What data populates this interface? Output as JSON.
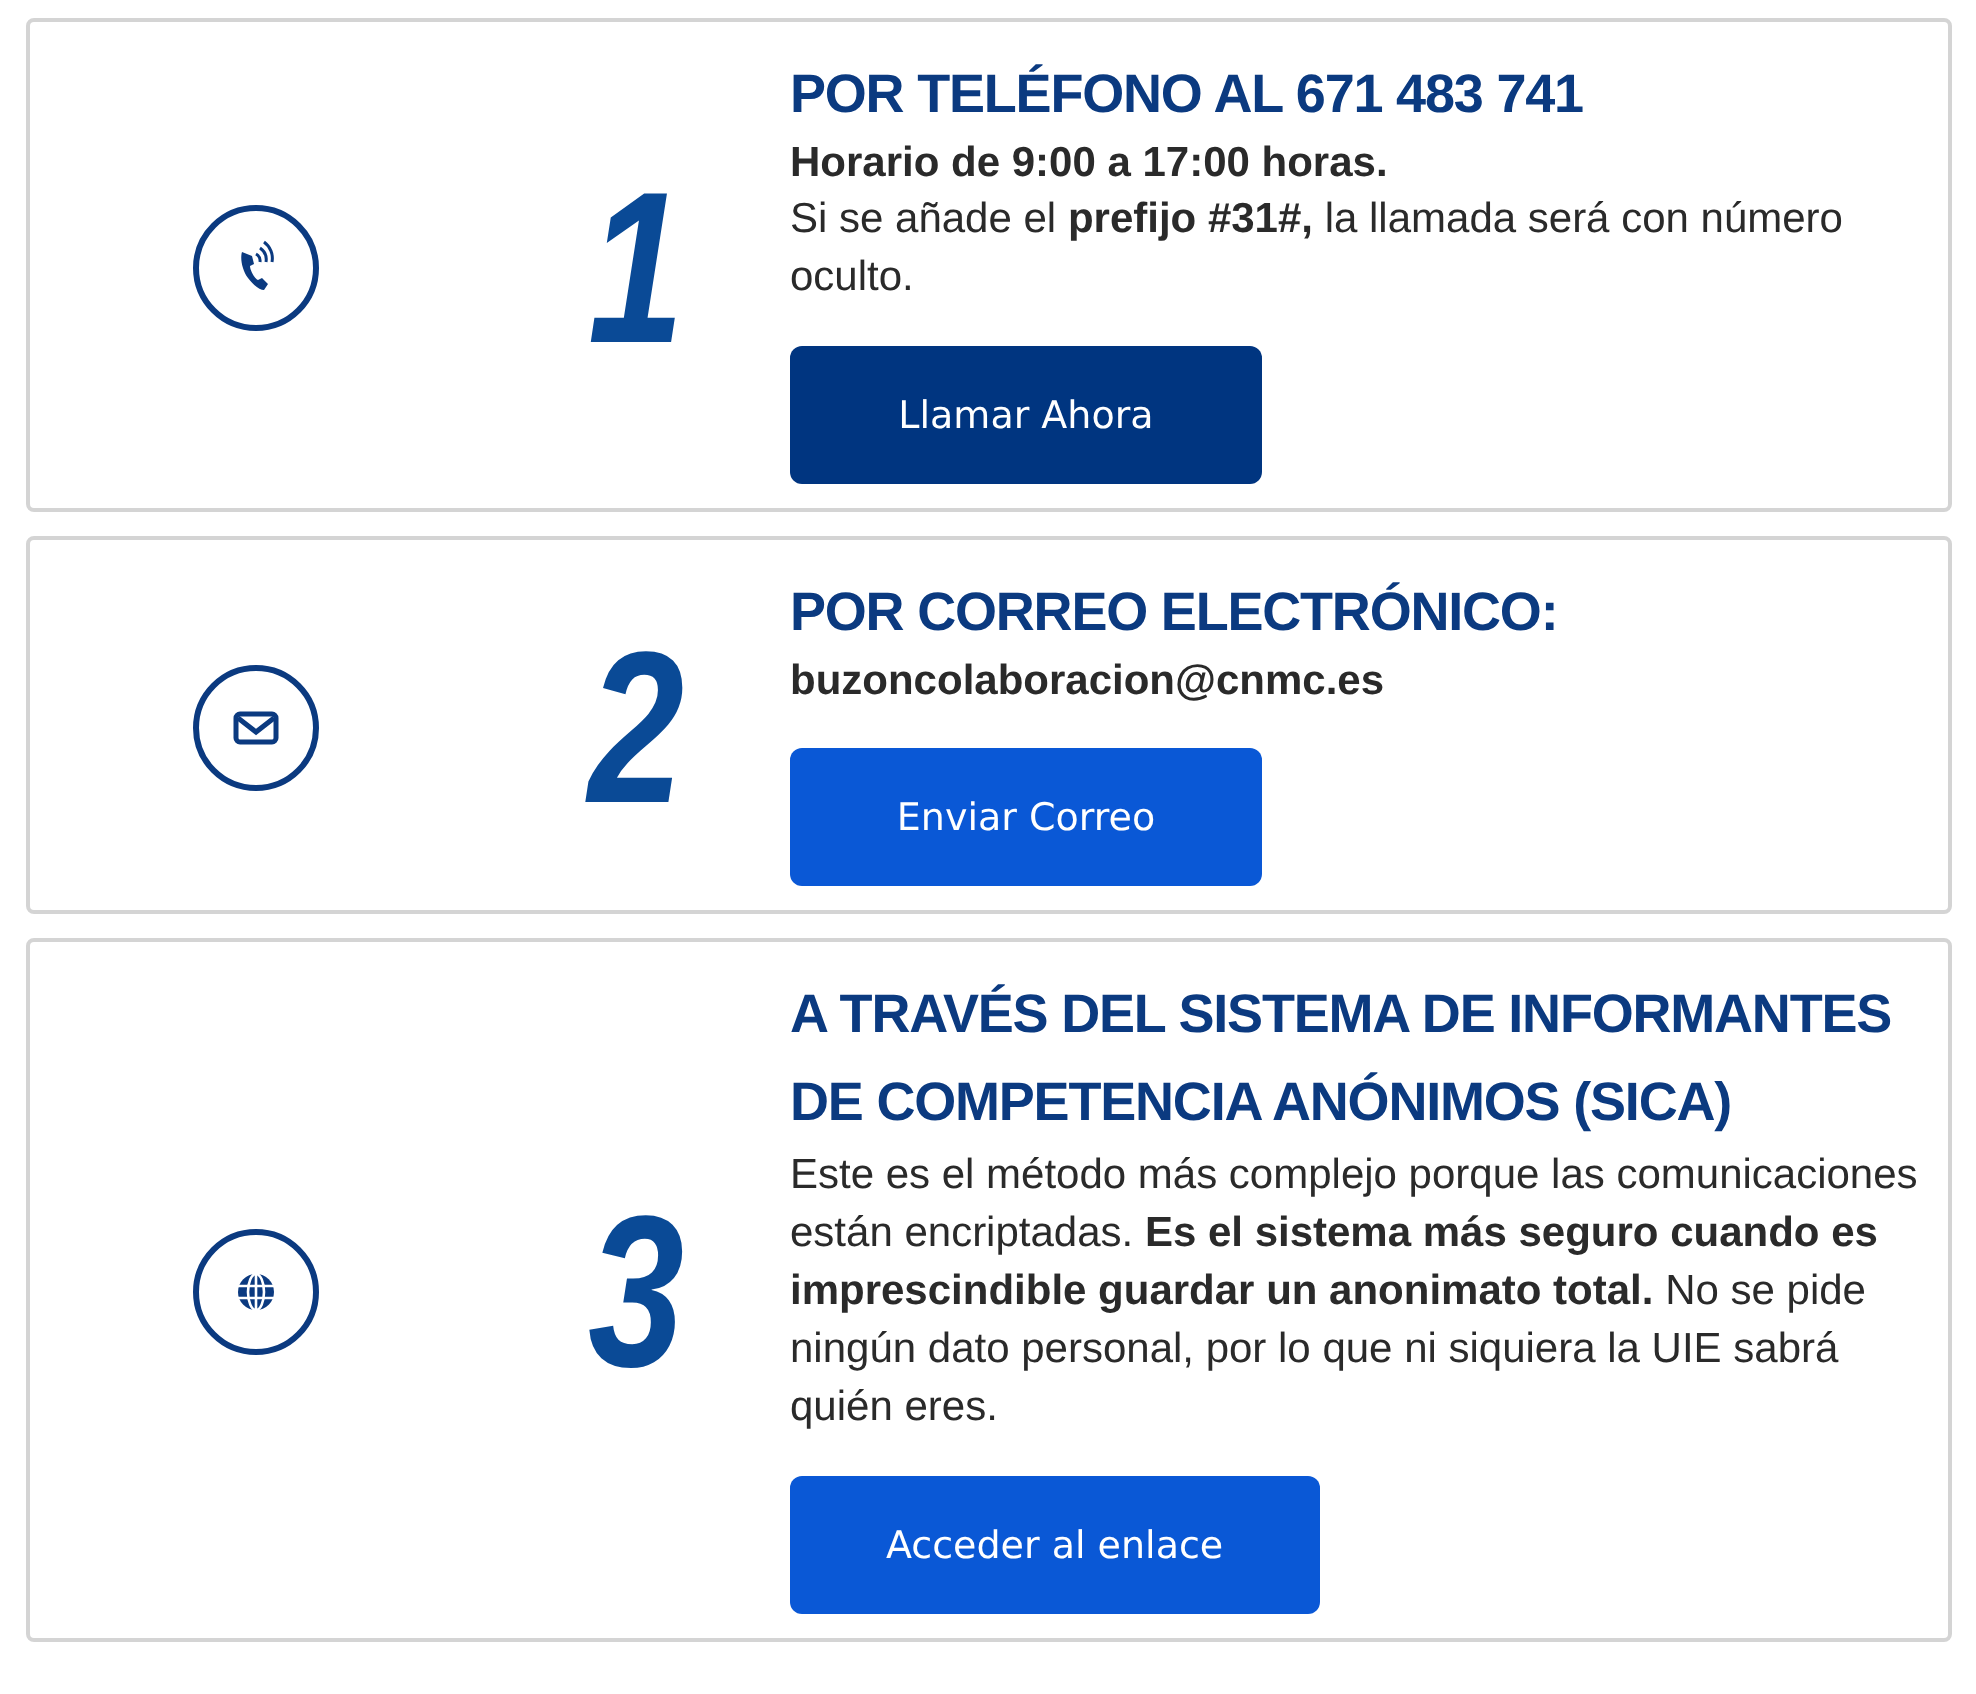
{
  "cards": [
    {
      "kind": "phone",
      "number": "1",
      "title": "POR TELÉFONO AL 671 483 741",
      "paragraphs": [
        {
          "text": "Horario de 9:00 a 17:00 horas.",
          "bold": true
        },
        {
          "text": "Si se añade el **prefijo #31#,** la llamada será con número oculto.",
          "bold": false
        }
      ],
      "button": {
        "label": "Llamar Ahora"
      }
    },
    {
      "kind": "mail",
      "number": "2",
      "title": "POR CORREO ELECTRÓNICO:",
      "paragraphs": [
        {
          "text": "buzoncolaboracion@cnmc.es",
          "bold": true
        }
      ],
      "button": {
        "label": "Enviar Correo"
      }
    },
    {
      "kind": "globe",
      "number": "3",
      "title": "A TRAVÉS DEL SISTEMA DE INFORMANTES DE COMPETENCIA ANÓNIMOS (SICA)",
      "paragraphs": [
        {
          "text": "Este es el método más complejo porque las comunicaciones están encriptadas. **Es el sistema más seguro cuando es imprescindible guardar un anonimato total.** No se pide ningún dato personal, por lo que ni siquiera la UIE sabrá quién eres.",
          "bold": false
        }
      ],
      "button": {
        "label": "Acceder al enlace"
      }
    }
  ]
}
